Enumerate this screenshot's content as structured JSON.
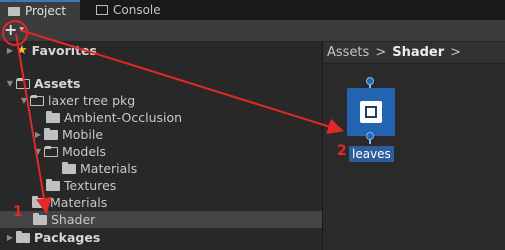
{
  "tabs": [
    {
      "label": "Project",
      "icon": "folder-icon"
    },
    {
      "label": "Console",
      "icon": "console-icon"
    }
  ],
  "toolbar": {
    "add_symbol": "+",
    "add_caret": "▾"
  },
  "tree": {
    "favorites": "Favorites",
    "assets": "Assets",
    "laxer_tree_pkg": "laxer tree pkg",
    "ambient_occlusion": "Ambient-Occlusion",
    "mobile": "Mobile",
    "models": "Models",
    "materials_inner": "Materials",
    "textures": "Textures",
    "materials": "Materials",
    "shader": "Shader",
    "packages": "Packages"
  },
  "breadcrumb": {
    "root": "Assets",
    "sep1": ">",
    "current": "Shader",
    "sep2": ">"
  },
  "asset": {
    "name": "leaves"
  },
  "annotations": {
    "one": "1",
    "two": "2",
    "color": "#e42727"
  }
}
